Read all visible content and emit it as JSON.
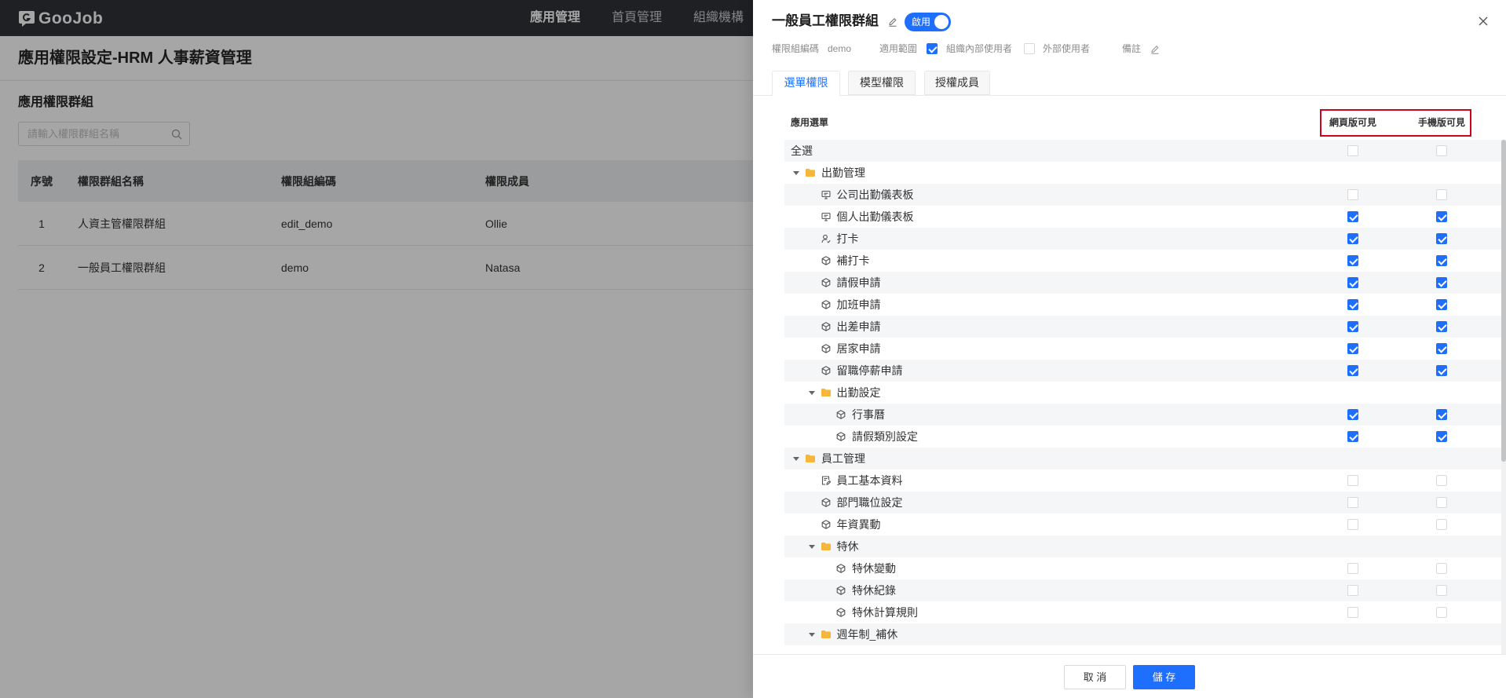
{
  "app": {
    "brand": "GooJob",
    "nav": [
      {
        "label": "應用管理",
        "active": true
      },
      {
        "label": "首頁管理",
        "active": false
      },
      {
        "label": "組織機構",
        "active": false
      }
    ]
  },
  "page": {
    "title": "應用權限設定-HRM 人事薪資管理",
    "section_title": "應用權限群組",
    "search": {
      "placeholder": "請輸入權限群組名稱",
      "value": ""
    },
    "table": {
      "columns": [
        "序號",
        "權限群組名稱",
        "權限組編碼",
        "權限成員"
      ],
      "rows": [
        {
          "no": "1",
          "name": "人資主管權限群組",
          "code": "edit_demo",
          "members": "Ollie"
        },
        {
          "no": "2",
          "name": "一般員工權限群組",
          "code": "demo",
          "members": "Natasa"
        }
      ]
    }
  },
  "drawer": {
    "title": "一般員工權限群組",
    "status": {
      "label": "啟用",
      "enabled": true
    },
    "meta": {
      "code_label": "權限組編碼",
      "code_value": "demo",
      "scope_label": "適用範圍",
      "scope_options": [
        {
          "label": "組織內部使用者",
          "checked": true
        },
        {
          "label": "外部使用者",
          "checked": false
        }
      ],
      "remark_label": "備註"
    },
    "tabs": [
      {
        "label": "選單權限",
        "active": true
      },
      {
        "label": "模型權限",
        "active": false
      },
      {
        "label": "授權成員",
        "active": false
      }
    ],
    "menu_table": {
      "header": {
        "menu": "應用選單",
        "web": "網頁版可見",
        "mobile": "手機版可見"
      },
      "select_all": {
        "label": "全選",
        "web_visible": false,
        "mobile_visible": false
      },
      "tree": [
        {
          "label": "出勤管理",
          "expanded": true,
          "children": [
            {
              "label": "公司出勤儀表板",
              "icon": "dashboard-icon",
              "web_visible": false,
              "mobile_visible": false
            },
            {
              "label": "個人出勤儀表板",
              "icon": "dashboard-icon",
              "web_visible": true,
              "mobile_visible": true
            },
            {
              "label": "打卡",
              "icon": "user-check-icon",
              "web_visible": true,
              "mobile_visible": true
            },
            {
              "label": "補打卡",
              "icon": "cube-icon",
              "web_visible": true,
              "mobile_visible": true
            },
            {
              "label": "請假申請",
              "icon": "cube-icon",
              "web_visible": true,
              "mobile_visible": true
            },
            {
              "label": "加班申請",
              "icon": "cube-icon",
              "web_visible": true,
              "mobile_visible": true
            },
            {
              "label": "出差申請",
              "icon": "cube-icon",
              "web_visible": true,
              "mobile_visible": true
            },
            {
              "label": "居家申請",
              "icon": "cube-icon",
              "web_visible": true,
              "mobile_visible": true
            },
            {
              "label": "留職停薪申請",
              "icon": "cube-icon",
              "web_visible": true,
              "mobile_visible": true
            },
            {
              "label": "出勤設定",
              "expanded": true,
              "children": [
                {
                  "label": "行事曆",
                  "icon": "cube-icon",
                  "web_visible": true,
                  "mobile_visible": true
                },
                {
                  "label": "請假類別設定",
                  "icon": "cube-icon",
                  "web_visible": true,
                  "mobile_visible": true
                }
              ]
            }
          ]
        },
        {
          "label": "員工管理",
          "expanded": true,
          "children": [
            {
              "label": "員工基本資料",
              "icon": "document-edit-icon",
              "web_visible": false,
              "mobile_visible": false
            },
            {
              "label": "部門職位設定",
              "icon": "cube-icon",
              "web_visible": false,
              "mobile_visible": false
            },
            {
              "label": "年資異動",
              "icon": "cube-icon",
              "web_visible": false,
              "mobile_visible": false
            },
            {
              "label": "特休",
              "expanded": true,
              "children": [
                {
                  "label": "特休變動",
                  "icon": "cube-icon",
                  "web_visible": false,
                  "mobile_visible": false
                },
                {
                  "label": "特休紀錄",
                  "icon": "cube-icon",
                  "web_visible": false,
                  "mobile_visible": false
                },
                {
                  "label": "特休計算規則",
                  "icon": "cube-icon",
                  "web_visible": false,
                  "mobile_visible": false
                }
              ]
            },
            {
              "label": "週年制_補休",
              "expanded": true,
              "children": []
            }
          ]
        }
      ]
    },
    "footer": {
      "cancel": "取 消",
      "save": "儲 存"
    }
  },
  "colors": {
    "primary": "#1f6fff",
    "highlight_border": "#d0021b",
    "folder": "#f5b63a"
  }
}
